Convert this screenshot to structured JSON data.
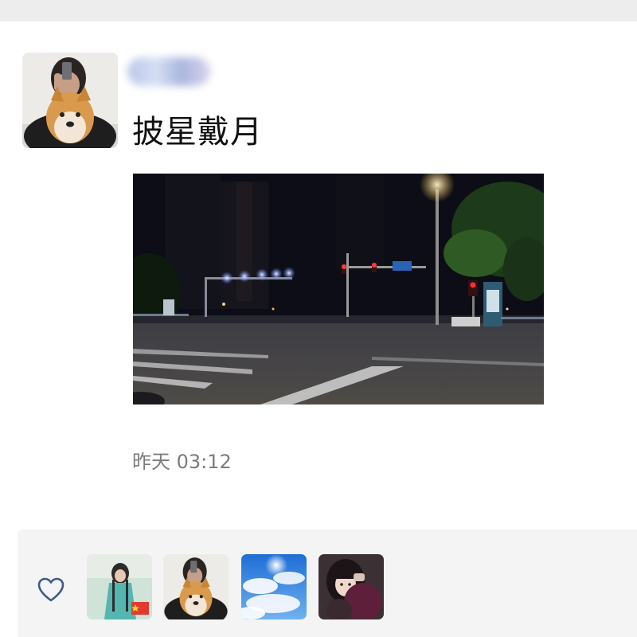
{
  "post": {
    "author_name": "",
    "text": "披星戴月",
    "timestamp": "昨天 03:12"
  },
  "icons": {
    "like": "heart-outline-icon",
    "flag": "china-flag-icon"
  },
  "colors": {
    "text_primary": "#111111",
    "text_secondary": "#7b7b7b",
    "panel_bg": "#f4f4f4",
    "like_icon": "#3d5a8a"
  },
  "likes": {
    "avatars": [
      "liker-avatar-1",
      "liker-avatar-2",
      "liker-avatar-3",
      "liker-avatar-4"
    ]
  }
}
